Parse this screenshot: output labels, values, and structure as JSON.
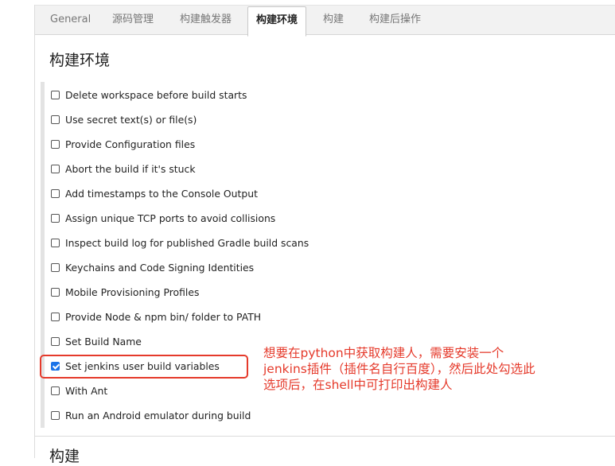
{
  "tabs": [
    "General",
    "源码管理",
    "构建触发器",
    "构建环境",
    "构建",
    "构建后操作"
  ],
  "active_tab": "构建环境",
  "section_title": "构建环境",
  "next_section_title": "构建",
  "options": [
    {
      "label": "Delete workspace before build starts",
      "checked": false
    },
    {
      "label": "Use secret text(s) or file(s)",
      "checked": false
    },
    {
      "label": "Provide Configuration files",
      "checked": false
    },
    {
      "label": "Abort the build if it's stuck",
      "checked": false
    },
    {
      "label": "Add timestamps to the Console Output",
      "checked": false
    },
    {
      "label": "Assign unique TCP ports to avoid collisions",
      "checked": false
    },
    {
      "label": "Inspect build log for published Gradle build scans",
      "checked": false
    },
    {
      "label": "Keychains and Code Signing Identities",
      "checked": false
    },
    {
      "label": "Mobile Provisioning Profiles",
      "checked": false
    },
    {
      "label": "Provide Node & npm bin/ folder to PATH",
      "checked": false
    },
    {
      "label": "Set Build Name",
      "checked": false
    },
    {
      "label": "Set jenkins user build variables",
      "checked": true
    },
    {
      "label": "With Ant",
      "checked": false
    },
    {
      "label": "Run an Android emulator during build",
      "checked": false
    }
  ],
  "annotation_lines": [
    "想要在python中获取构建人，需要安装一个",
    "jenkins插件（插件名自行百度），然后此处勾选此",
    "选项后，在shell中可打印出构建人"
  ],
  "colors": {
    "annotation": "#e53a2b",
    "checkbox_checked": "#1a73e8"
  }
}
